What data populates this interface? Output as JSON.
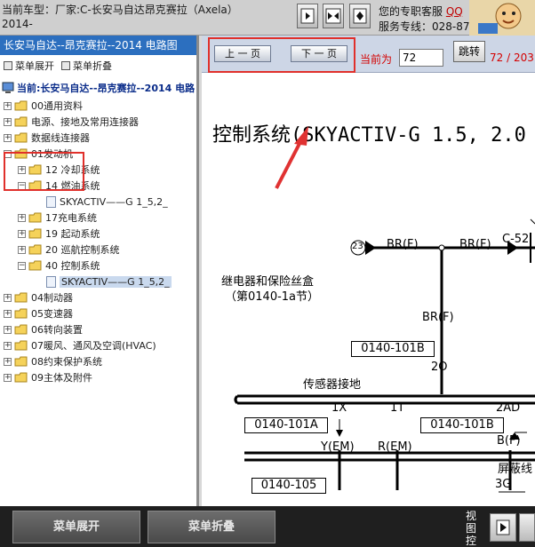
{
  "header": {
    "car_model_line1": "当前车型：厂家:C-长安马自达昂克赛拉（Axela）",
    "car_model_line2": "2014-",
    "support_line1": "您的专职客服",
    "support_qq": "QQ",
    "support_line2": "服务专线：028-87"
  },
  "left": {
    "title": "长安马自达--昂克赛拉--2014 电路图",
    "toolbar": {
      "expand": "菜单展开",
      "collapse": "菜单折叠"
    },
    "root": "当前:长安马自达--昂克赛拉--2014 电路",
    "tree": [
      "00通用资料",
      "电源、接地及常用连接器",
      "数据线连接器",
      "01发动机",
      "12 冷却系统",
      "14 燃油系统",
      "SKYACTIV——G 1_5,2_",
      "17充电系统",
      "19 起动系统",
      "20 巡航控制系统",
      "40 控制系统",
      "SKYACTIV——G 1_5,2_",
      "04制动器",
      "05变速器",
      "06转向装置",
      "07暖风、通风及空调(HVAC)",
      "08约束保护系统",
      "09主体及附件"
    ]
  },
  "nav": {
    "prev": "上 一 页",
    "next": "下 一 页",
    "current_label": "当前为",
    "current_page": "72",
    "jump": "跳转",
    "page_count": "72 / 203"
  },
  "diagram": {
    "title": "控制系统(SKYACTIV-G 1.5, 2.0",
    "relay_box": "继电器和保险丝盒",
    "relay_box_sub": "（第0140-1a节）",
    "circle_23": "23",
    "br_f_1": "BR(F)",
    "br_f_2": "BR(F)",
    "c52": "C-52",
    "br_f_3": "BR(F)",
    "box_0140_101b_1": "0140-101B",
    "n_2o": "2O",
    "sensor_ground": "传感器接地",
    "n_1x": "1X",
    "n_1t": "1T",
    "n_2ad": "2AD",
    "box_0140_101a": "0140-101A",
    "box_0140_101b_2": "0140-101B",
    "y_em": "Y(EM)",
    "r_em": "R(EM)",
    "b_f": "B(F)",
    "shield": "屏蔽线",
    "box_0140_105": "0140-105",
    "n_3g": "3G"
  },
  "bottom": {
    "expand": "菜单展开",
    "collapse": "菜单折叠",
    "view_ctrl": "视图控"
  },
  "colors": {
    "title_bar": "#2c6fbf",
    "nav_bar": "#cdd6e6",
    "highlight": "#e0302b",
    "page_text": "#d40000"
  },
  "icons": [
    "single-page-icon",
    "dual-page-icon",
    "fit-page-icon",
    "folder-icon",
    "document-icon",
    "expand-icon",
    "next-arrow-icon"
  ]
}
